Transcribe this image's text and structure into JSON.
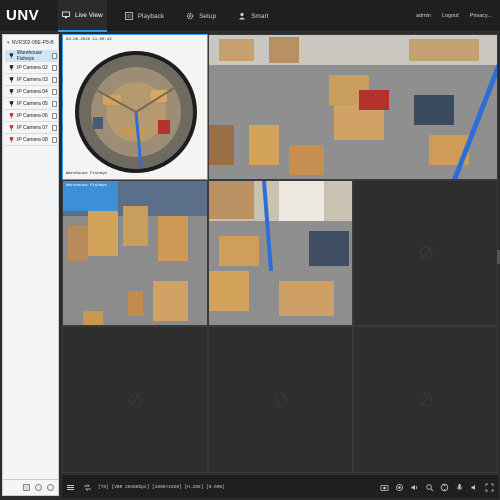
{
  "header": {
    "logo_text": "UNV",
    "nav": [
      {
        "label": "Live View",
        "icon": "monitor-icon",
        "active": true
      },
      {
        "label": "Playback",
        "icon": "playback-icon",
        "active": false
      },
      {
        "label": "Setup",
        "icon": "gear-icon",
        "active": false
      },
      {
        "label": "Smart",
        "icon": "smart-icon",
        "active": false
      }
    ],
    "user_links": [
      "admin",
      "Logout",
      "Privacy..."
    ]
  },
  "sidebar": {
    "root_label": "NVR302-08E-P8-B",
    "cameras": [
      {
        "label": "Warehouse Fisheye",
        "selected": true,
        "status_color": "#2a2a2a"
      },
      {
        "label": "IP Camera 02",
        "selected": false,
        "status_color": "#2a2a2a"
      },
      {
        "label": "IP Camera 03",
        "selected": false,
        "status_color": "#2a2a2a"
      },
      {
        "label": "IP Camera 04",
        "selected": false,
        "status_color": "#2a2a2a"
      },
      {
        "label": "IP Camera 05",
        "selected": false,
        "status_color": "#2a2a2a"
      },
      {
        "label": "IP Camera 06",
        "selected": false,
        "status_color": "#c0392b"
      },
      {
        "label": "IP Camera 07",
        "selected": false,
        "status_color": "#c0392b"
      },
      {
        "label": "IP Camera 08",
        "selected": false,
        "status_color": "#c0392b"
      }
    ]
  },
  "tiles": {
    "tile1_timestamp": "03-06-2020 11:00:42",
    "tile1_name": "Warehouse Fisheye",
    "tile4_name": "Warehouse Fisheye"
  },
  "toolbar": {
    "status_text": "[TS] [VBR 2048Kbps] [2880×1920] [H.265] [0.00%]"
  },
  "colors": {
    "accent": "#3aa0ff",
    "topbar_bg": "#1f1f1f",
    "empty_tile": "#2e2e2e"
  }
}
